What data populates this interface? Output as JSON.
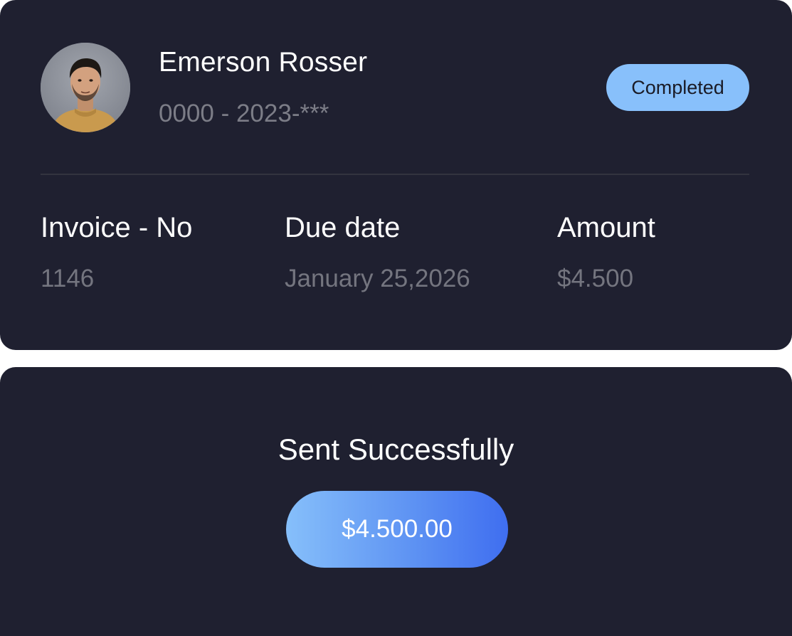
{
  "invoice": {
    "customer_name": "Emerson Rosser",
    "account_number": "0000 - 2023-***",
    "status": "Completed",
    "columns": [
      {
        "label": "Invoice - No",
        "value": "1146"
      },
      {
        "label": "Due date",
        "value": "January 25,2026"
      },
      {
        "label": "Amount",
        "value": "$4.500"
      }
    ]
  },
  "confirmation": {
    "title": "Sent Successfully",
    "amount": "$4.500.00"
  },
  "colors": {
    "card_background": "#1f2030",
    "badge": "#88c0fb",
    "button_gradient_start": "#86bffa",
    "button_gradient_end": "#3f6ef0",
    "muted_text": "#7c7d87"
  },
  "icons": {
    "avatar": "user-photo-avatar"
  }
}
